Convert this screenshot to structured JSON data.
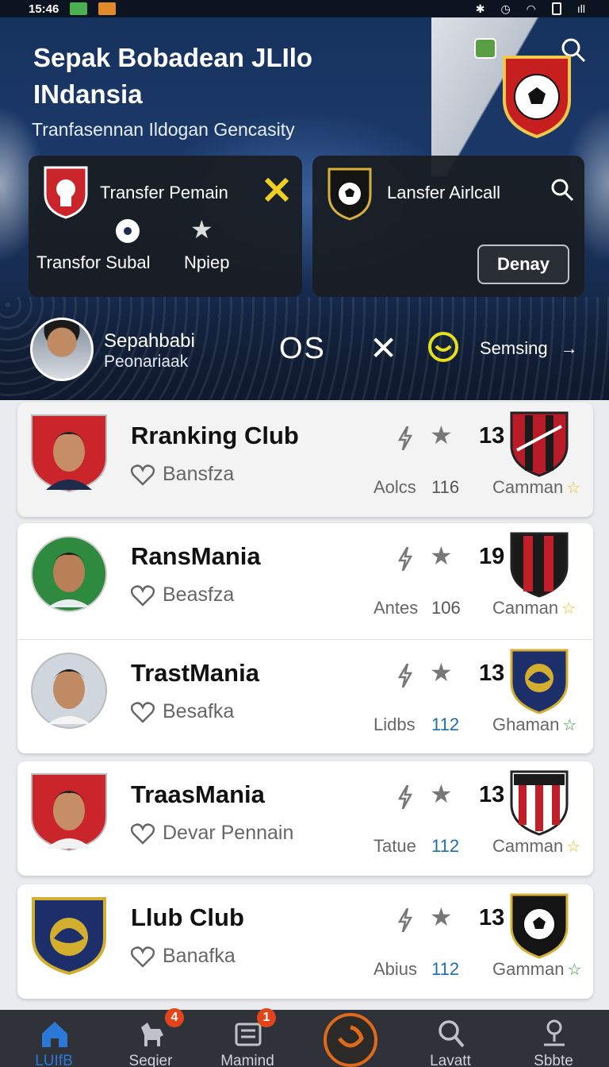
{
  "status": {
    "time": "15:46",
    "battery": "ıll"
  },
  "hero": {
    "title": "Sepak Bobadean JLIlo INdansia",
    "subtitle": "Tranfasennan Ildogan Gencasity"
  },
  "card_left": {
    "title": "Transfer Pemain",
    "label1": "Transfor Subal",
    "label2": "Npiep"
  },
  "card_right": {
    "title": "Lansfer Airlcall",
    "button": "Denay"
  },
  "profile": {
    "name": "Sepahbabi",
    "sub": "Peonariaak",
    "badge": "OS",
    "link": "Semsing"
  },
  "rows": [
    {
      "name": "Rranking Club",
      "fav": "Bansfza",
      "num": "13",
      "lbl": "Aolcs",
      "val": "116",
      "club": "Camman",
      "star_color": "#e6c21c"
    },
    {
      "name": "RansMania",
      "fav": "Beasfza",
      "num": "19",
      "lbl": "Antes",
      "val": "106",
      "club": "Canman",
      "star_color": "#e6c21c"
    },
    {
      "name": "TrastMania",
      "fav": "Besafka",
      "num": "13",
      "lbl": "Lidbs",
      "val": "112",
      "club": "Ghaman",
      "star_color": "#2a9a3a"
    },
    {
      "name": "TraasMania",
      "fav": "Devar Pennain",
      "num": "13",
      "lbl": "Tatue",
      "val": "112",
      "club": "Camman",
      "star_color": "#e6c21c"
    },
    {
      "name": "Llub Club",
      "fav": "Banafka",
      "num": "13",
      "lbl": "Abius",
      "val": "112",
      "club": "Gamman",
      "star_color": "#2a9a3a"
    }
  ],
  "nav": [
    {
      "label": "LUIfB"
    },
    {
      "label": "Seqier",
      "badge": "4"
    },
    {
      "label": "Mamind",
      "badge": "1"
    },
    {
      "label": ""
    },
    {
      "label": "Lavatt"
    },
    {
      "label": "Sbbte"
    }
  ],
  "colors": {
    "accent": "#2c78d8",
    "badge": "#e2451b",
    "hero": "#1c3a6a",
    "gold": "#f0d21e"
  }
}
